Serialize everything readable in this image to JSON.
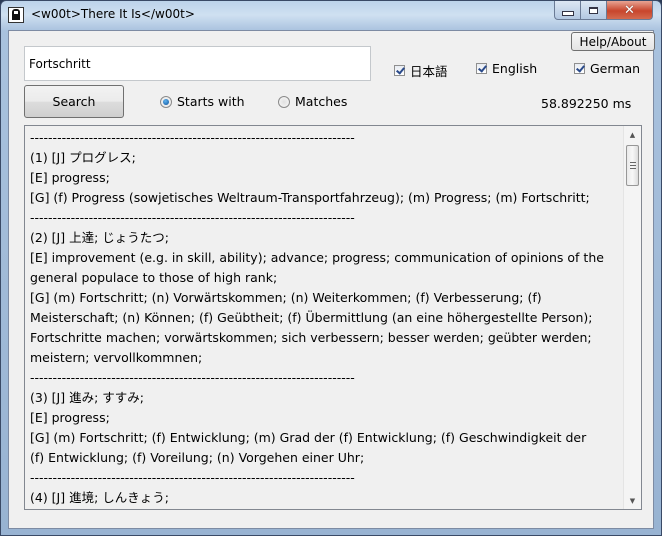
{
  "window": {
    "title": "<w00t>There It Is</w00t>",
    "icon": "app-icon",
    "controls": {
      "minimize": "minimize-icon",
      "maximize": "maximize-icon",
      "close": "✕"
    }
  },
  "toolbar": {
    "help_label": "Help/About",
    "search_value": "Fortschritt",
    "search_label": "Search",
    "languages": [
      {
        "label": "日本語",
        "checked": true
      },
      {
        "label": "English",
        "checked": true
      },
      {
        "label": "German",
        "checked": true
      }
    ],
    "match_modes": [
      {
        "label": "Starts with",
        "selected": true
      },
      {
        "label": "Matches",
        "selected": false
      }
    ],
    "timing": "58.892250 ms"
  },
  "results": {
    "lines": [
      "------------------------------------------------------------------------",
      "(1) [J] プログレス;",
      "[E] progress;",
      "[G] (f) Progress (sowjetisches Weltraum-Transportfahrzeug); (m) Progress; (m) Fortschritt;",
      "------------------------------------------------------------------------",
      "(2) [J] 上達; じょうたつ;",
      "[E] improvement (e.g. in skill, ability); advance; progress; communication of opinions of the",
      "general populace to those of high rank;",
      "[G] (m) Fortschritt; (n) Vorwärtskommen; (n) Weiterkommen; (f) Verbesserung; (f)",
      "Meisterschaft; (n) Können; (f) Geübtheit; (f) Übermittlung (an eine höhergestellte Person);",
      "Fortschritte machen; vorwärtskommen; sich verbessern; besser werden; geübter werden;",
      "meistern; vervollkommnen;",
      "------------------------------------------------------------------------",
      "(3) [J] 進み; すすみ;",
      "[E] progress;",
      "[G] (m) Fortschritt; (f) Entwicklung; (m) Grad der (f) Entwicklung; (f) Geschwindigkeit der",
      "(f) Entwicklung; (f) Voreilung; (n) Vorgehen einer Uhr;",
      "------------------------------------------------------------------------",
      "(4) [J] 進境; しんきょう;"
    ],
    "scroll_up": "▲",
    "scroll_down": "▼"
  }
}
